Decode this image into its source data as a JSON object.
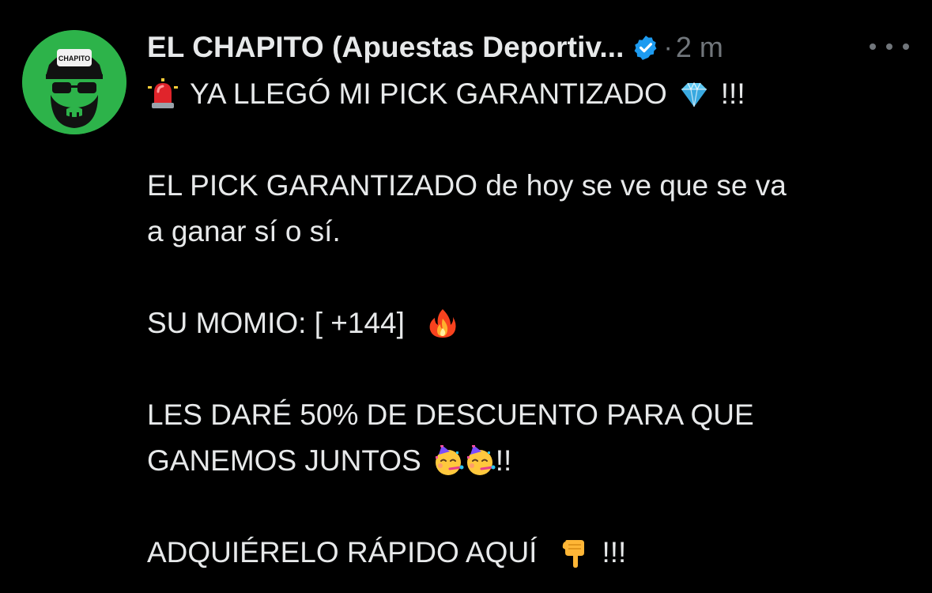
{
  "post": {
    "author_name": "EL CHAPITO (Apuestas Deportiv...",
    "separator": "·",
    "time": "2 m",
    "avatar_text": "CHAPITO",
    "avatar_color": "#2db34a",
    "verified_color": "#1d9bf0",
    "lines": {
      "l1_text": "YA LLEGÓ MI PICK GARANTIZADO",
      "l1_end": "!!!",
      "l2": "EL PICK GARANTIZADO de hoy se ve que se va",
      "l3": "a ganar sí o sí.",
      "l4_text": "SU MOMIO: [ +144]",
      "l5": "LES DARÉ 50% DE DESCUENTO PARA QUE",
      "l6_text": "GANEMOS JUNTOS",
      "l6_end": "!!",
      "l7_text": "ADQUIÉRELO RÁPIDO AQUÍ",
      "l7_end": "!!!"
    },
    "icons": {
      "siren": "police-light-emoji",
      "gem": "gem-stone-emoji",
      "fire": "fire-emoji",
      "party": "partying-face-emoji",
      "point": "backhand-index-pointing-down-emoji",
      "verified": "verified-badge-icon",
      "more": "more-options-icon"
    }
  }
}
